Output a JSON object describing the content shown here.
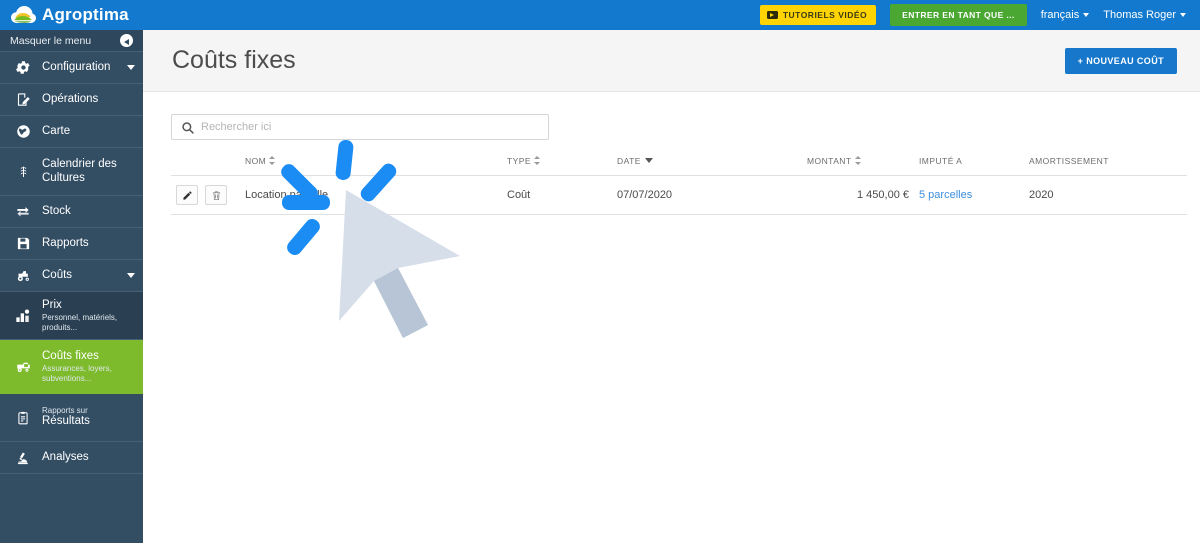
{
  "topbar": {
    "brand": "Agroptima",
    "logo_icon": "cloud-field-logo",
    "tutorials_label": "TUTORIELS VIDÉO",
    "tutorials_icon": "video-icon",
    "enter_as_label": "ENTRER EN TANT QUE ...",
    "language": "français",
    "user": "Thomas Roger",
    "caret_icon": "caret-down-icon",
    "colors": {
      "bar": "#1279CE",
      "tutorials": "#FFD400",
      "enter_as": "#4AA832"
    }
  },
  "sidebar": {
    "hide_menu_label": "Masquer le menu",
    "hide_menu_icon": "collapse-circle-icon",
    "active_color": "#7DBB2C",
    "bg_color": "#334D63",
    "items": [
      {
        "label": "Configuration",
        "sub": "",
        "sup": "",
        "icon": "gear-icon",
        "chevron": true,
        "active": false,
        "name": "configuration"
      },
      {
        "label": "Opérations",
        "sub": "",
        "sup": "",
        "icon": "clipboard-pencil-icon",
        "chevron": false,
        "active": false,
        "name": "operations"
      },
      {
        "label": "Carte",
        "sub": "",
        "sup": "",
        "icon": "globe-icon",
        "chevron": false,
        "active": false,
        "name": "carte"
      },
      {
        "label": "Calendrier des Cultures",
        "sub": "",
        "sup": "",
        "icon": "wheat-icon",
        "chevron": false,
        "active": false,
        "name": "calendrier-des-cultures"
      },
      {
        "label": "Stock",
        "sub": "",
        "sup": "",
        "icon": "transfer-arrows-icon",
        "chevron": false,
        "active": false,
        "name": "stock"
      },
      {
        "label": "Rapports",
        "sub": "",
        "sup": "",
        "icon": "save-report-icon",
        "chevron": false,
        "active": false,
        "name": "rapports"
      },
      {
        "label": "Coûts",
        "sub": "",
        "sup": "",
        "icon": "tractor-icon",
        "chevron": true,
        "active": false,
        "name": "couts"
      },
      {
        "label": "Prix",
        "sub": "Personnel, matériels, produits...",
        "sup": "",
        "icon": "price-tag-icon",
        "chevron": false,
        "active": false,
        "name": "prix"
      },
      {
        "label": "Coûts fixes",
        "sub": "Assurances, loyers, subventions...",
        "sup": "",
        "icon": "fixed-cost-icon",
        "chevron": false,
        "active": true,
        "name": "couts-fixes"
      },
      {
        "label": "Résultats",
        "sub": "",
        "sup": "Rapports sur",
        "icon": "document-icon",
        "chevron": false,
        "active": false,
        "name": "rapports-sur-resultats"
      },
      {
        "label": "Analyses",
        "sub": "",
        "sup": "",
        "icon": "microscope-icon",
        "chevron": false,
        "active": false,
        "name": "analyses"
      }
    ]
  },
  "page": {
    "title": "Coûts fixes",
    "new_button_label": "+ NOUVEAU COÛT",
    "new_button_color": "#1777CB"
  },
  "search": {
    "placeholder": "Rechercher ici",
    "value": "",
    "icon": "search-icon"
  },
  "table": {
    "columns": [
      {
        "label": "",
        "sort": "none",
        "key": "actions"
      },
      {
        "label": "NOM",
        "sort": "both",
        "key": "nom"
      },
      {
        "label": "TYPE",
        "sort": "both",
        "key": "type"
      },
      {
        "label": "DATE",
        "sort": "desc",
        "key": "date"
      },
      {
        "label": "MONTANT",
        "sort": "both",
        "key": "montant"
      },
      {
        "label": "IMPUTÉ A",
        "sort": "none",
        "key": "impute"
      },
      {
        "label": "AMORTISSEMENT",
        "sort": "none",
        "key": "amortissement"
      }
    ],
    "rows": [
      {
        "edit_icon": "pencil-icon",
        "delete_icon": "trash-icon",
        "nom": "Location parcelle",
        "type": "Coût",
        "date": "07/07/2020",
        "montant": "1 450,00 €",
        "impute": "5 parcelles",
        "amortissement": "2020"
      }
    ]
  },
  "cursor": {
    "pointer_icon": "mouse-pointer-icon",
    "click_burst_icon": "click-burst-icon",
    "burst_color": "#1B8CF3",
    "pointer_color": "#D6DEEA"
  }
}
